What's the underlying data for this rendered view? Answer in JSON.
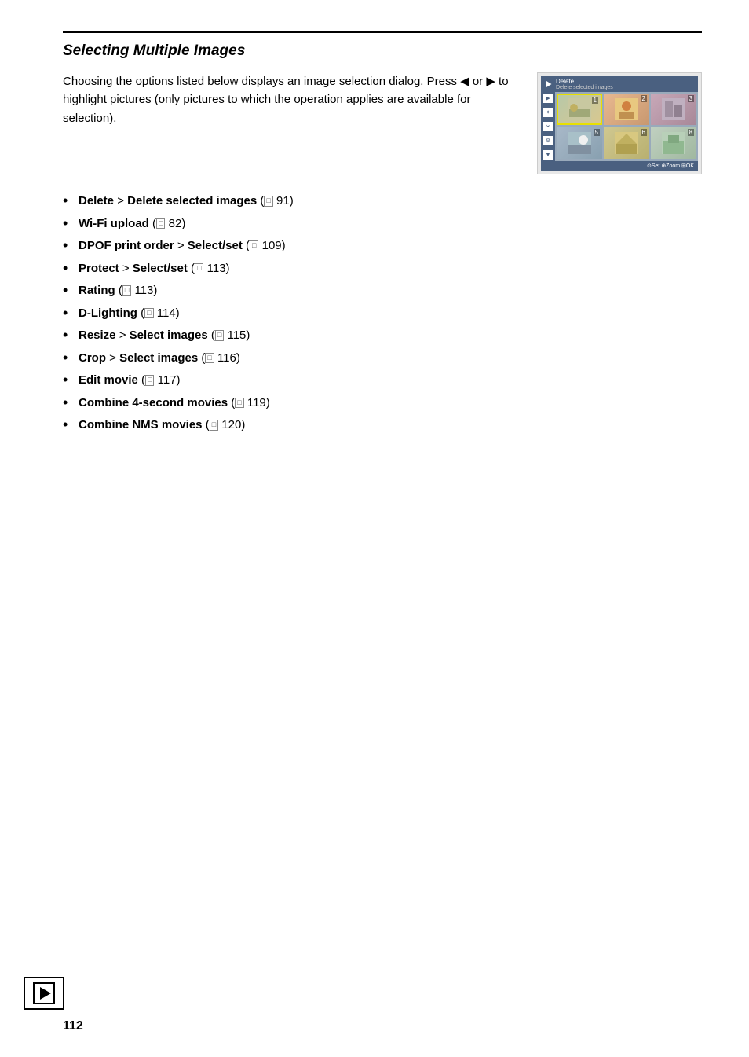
{
  "page": {
    "number": "112"
  },
  "section": {
    "title": "Selecting Multiple Images",
    "intro": "Choosing the options listed below displays an image selection dialog. Press ◀ or ▶ to highlight pictures (only pictures to which the operation applies are available for selection).",
    "bullets": [
      {
        "id": 1,
        "bold_part": "Delete",
        "separator": " > ",
        "bold_part2": "Delete selected images",
        "ref": "□ 91",
        "normal": ""
      },
      {
        "id": 2,
        "bold_part": "Wi-Fi upload",
        "ref": "□ 82",
        "normal": ""
      },
      {
        "id": 3,
        "bold_part": "DPOF print order",
        "separator": " > ",
        "bold_part2": "Select/set",
        "ref": "□ 109",
        "normal": ""
      },
      {
        "id": 4,
        "bold_part": "Protect",
        "separator": " > ",
        "bold_part2": "Select/set",
        "ref": "□ 113",
        "normal": ""
      },
      {
        "id": 5,
        "bold_part": "Rating",
        "ref": "□ 113",
        "normal": ""
      },
      {
        "id": 6,
        "bold_part": "D-Lighting",
        "ref": "□ 114",
        "normal": ""
      },
      {
        "id": 7,
        "bold_part": "Resize",
        "separator": " > ",
        "bold_part2": "Select images",
        "ref": "□ 115",
        "normal": ""
      },
      {
        "id": 8,
        "bold_part": "Crop",
        "separator": " > ",
        "bold_part2": "Select images",
        "ref": "□ 116",
        "normal": ""
      },
      {
        "id": 9,
        "bold_part": "Edit movie",
        "ref": "□ 117",
        "normal": ""
      },
      {
        "id": 10,
        "bold_part": "Combine 4-second movies",
        "ref": "□ 119",
        "normal": ""
      },
      {
        "id": 11,
        "bold_part": "Combine NMS movies",
        "ref": "□ 120",
        "normal": ""
      }
    ]
  },
  "camera_screen": {
    "menu_title": "Delete",
    "menu_sub": "Delete selected images",
    "bottom_bar": "⊙Set ⊕Zoom ⊞OK",
    "left_icons": [
      "▶",
      "✦",
      "❊",
      "⚙",
      "↓"
    ]
  }
}
